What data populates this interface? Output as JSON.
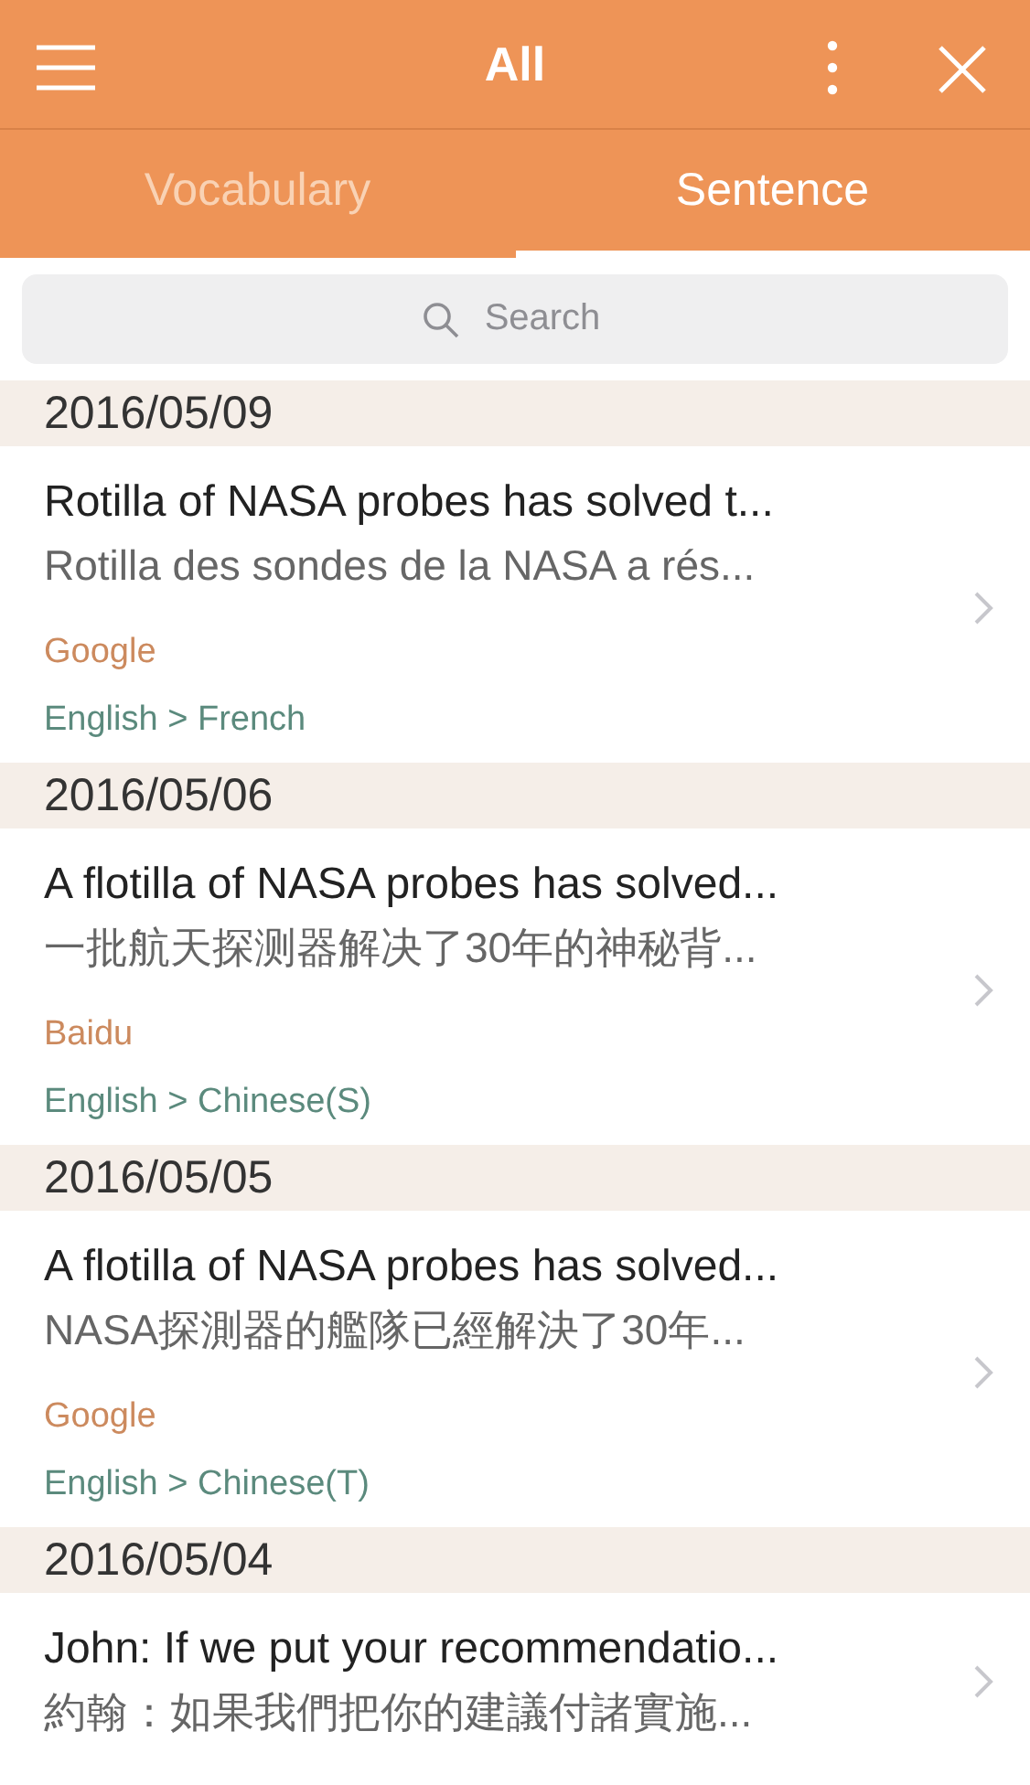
{
  "header": {
    "title": "All"
  },
  "tabs": [
    {
      "label": "Vocabulary",
      "selected": false
    },
    {
      "label": "Sentence",
      "selected": true
    }
  ],
  "search": {
    "placeholder": "Search"
  },
  "groups": [
    {
      "date": "2016/05/09",
      "entries": [
        {
          "source_text": "Rotilla of NASA probes has solved t...",
          "translation": "Rotilla des sondes de la NASA a rés...",
          "engine": "Google",
          "languages": "English > French"
        }
      ]
    },
    {
      "date": "2016/05/06",
      "entries": [
        {
          "source_text": "A flotilla of NASA probes has solved...",
          "translation": "一批航天探测器解决了30年的神秘背...",
          "engine": "Baidu",
          "languages": "English > Chinese(S)"
        }
      ]
    },
    {
      "date": "2016/05/05",
      "entries": [
        {
          "source_text": "A flotilla of NASA probes has solved...",
          "translation": "NASA探測器的艦隊已經解決了30年...",
          "engine": "Google",
          "languages": "English > Chinese(T)"
        }
      ]
    },
    {
      "date": "2016/05/04",
      "entries": [
        {
          "source_text": "John: If we put your recommendatio...",
          "translation": "約翰：如果我們把你的建議付諸實施..."
        }
      ]
    }
  ]
}
